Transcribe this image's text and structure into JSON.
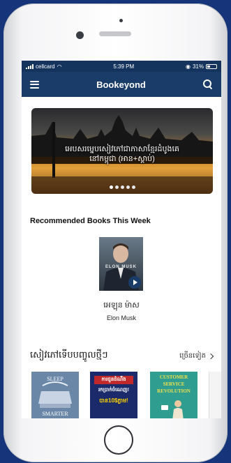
{
  "status": {
    "carrier": "cellcard",
    "time": "5:39 PM",
    "battery": "31%"
  },
  "header": {
    "title": "Bookeyond"
  },
  "banner": {
    "caption_line1": "អេបសរម្នេបសៀវភៅជាភាសាខ្មែរដំបូងគេ",
    "caption_line2": "នៅកម្ពុជា (អាន+ស្តាប់)",
    "dots": 5,
    "active_dot": 0
  },
  "recommended": {
    "title": "Recommended Books This Week",
    "book": {
      "cover_text": "ELON MUSK",
      "title_km": "អេឡុន ម៉ាស",
      "author": "Elon Musk"
    }
  },
  "new_books": {
    "title": "សៀវភៅទើបបញ្ចូលថ្មីៗ",
    "see_more": "ច្រើនទៀត",
    "items": [
      {
        "line1": "SLEEP",
        "line2": "SMARTER"
      },
      {
        "line1": "ការជួនដំណឹង",
        "line2": "រកប្រាក់ចំណេញ!",
        "line3": "បាន10$ភ្លាម!"
      },
      {
        "line1": "CUSTOMER",
        "line2": "SERVICE",
        "line3": "REVOLUTION"
      }
    ]
  },
  "colors": {
    "navbar": "#1a3c68",
    "background": "#15347a"
  }
}
